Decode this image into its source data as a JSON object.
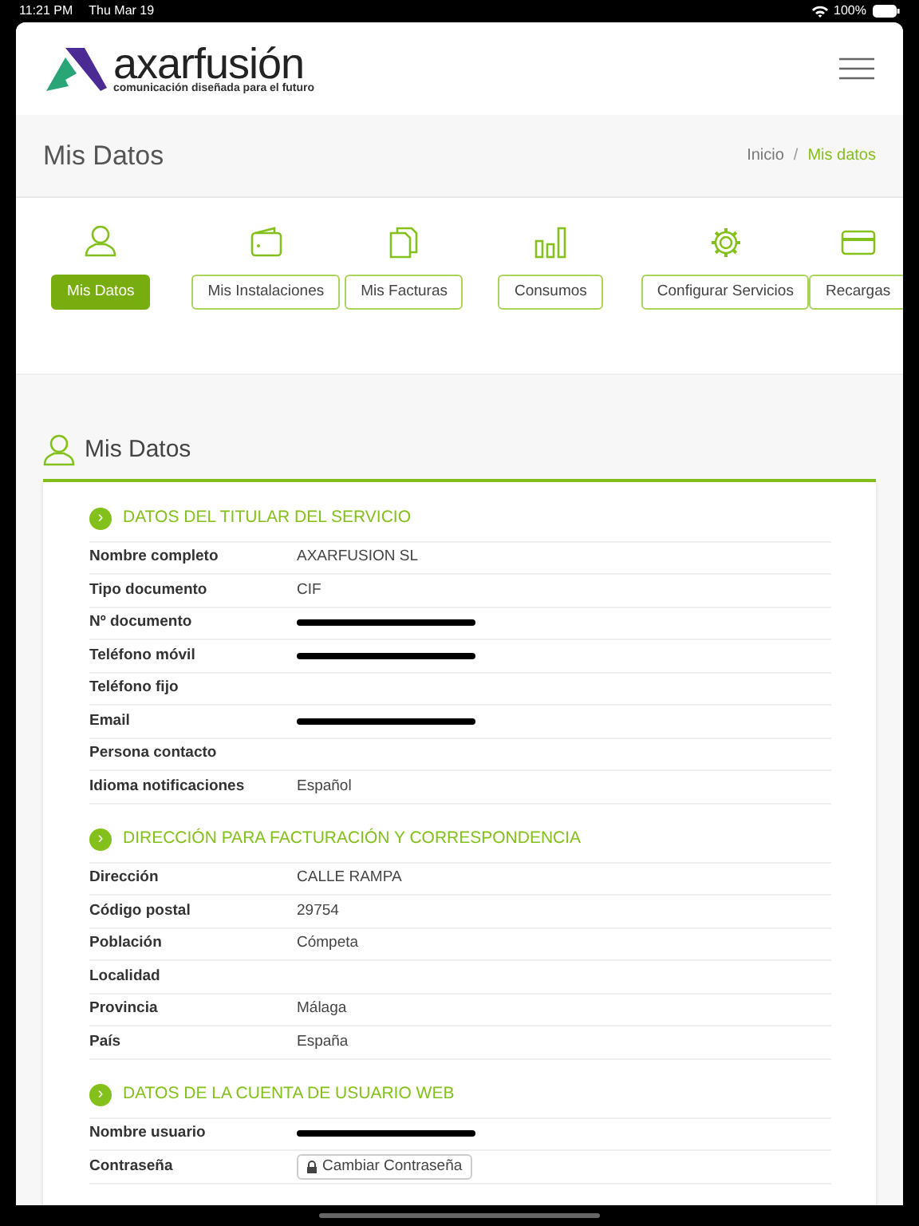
{
  "status_bar": {
    "time": "11:21 PM",
    "date": "Thu Mar 19",
    "battery": "100%"
  },
  "logo": {
    "name": "axarfusión",
    "tagline": "comunicación diseñada para el futuro"
  },
  "page_title": "Mis Datos",
  "breadcrumb": [
    {
      "label": "Inicio",
      "selected": false
    },
    {
      "label": "Mis datos",
      "selected": true
    }
  ],
  "breadcrumb_separator": "/",
  "section_marker": "›",
  "nav": [
    {
      "label": "Mis Datos",
      "selected": true
    },
    {
      "label": "Mis Instalaciones",
      "selected": false
    },
    {
      "label": "Mis Facturas",
      "selected": false
    },
    {
      "label": "Consumos",
      "selected": false
    },
    {
      "label": "Configurar Servicios",
      "selected": false
    },
    {
      "label": "Recargas",
      "selected": false
    }
  ],
  "panel_title": "Mis Datos",
  "sections": [
    {
      "title": "DATOS DEL TITULAR DEL SERVICIO",
      "rows": [
        {
          "label": "Nombre completo",
          "value": "AXARFUSION SL"
        },
        {
          "label": "Tipo documento",
          "value": "CIF"
        },
        {
          "label": "Nº documento",
          "redacted": true
        },
        {
          "label": "Teléfono móvil",
          "redacted": true
        },
        {
          "label": "Teléfono fijo"
        },
        {
          "label": "Email",
          "redacted": true
        },
        {
          "label": "Persona contacto"
        },
        {
          "label": "Idioma notificaciones",
          "value": "Español"
        }
      ]
    },
    {
      "title": "DIRECCIÓN PARA FACTURACIÓN Y CORRESPONDENCIA",
      "rows": [
        {
          "label": "Dirección",
          "value": "CALLE RAMPA"
        },
        {
          "label": "Código postal",
          "value": "29754"
        },
        {
          "label": "Población",
          "value": "Cómpeta"
        },
        {
          "label": "Localidad"
        },
        {
          "label": "Provincia",
          "value": "Málaga"
        },
        {
          "label": "País",
          "value": "España"
        }
      ]
    },
    {
      "title": "DATOS DE LA CUENTA DE USUARIO WEB",
      "rows": [
        {
          "label": "Nombre usuario",
          "redacted": true
        },
        {
          "label": "Contraseña",
          "button": "Cambiar Contraseña"
        }
      ]
    }
  ]
}
